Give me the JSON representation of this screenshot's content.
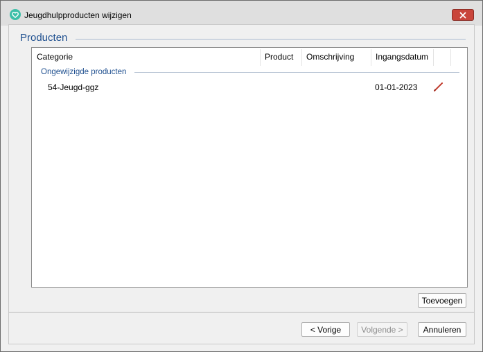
{
  "window": {
    "title": "Jeugdhulpproducten wijzigen",
    "icon": "heart-icon",
    "accent_color": "#3dbfa8"
  },
  "section": {
    "title": "Producten"
  },
  "table": {
    "columns": [
      "Categorie",
      "Product",
      "Omschrijving",
      "Ingangsdatum"
    ],
    "group": {
      "label": "Ongewijzigde producten",
      "rows": [
        {
          "categorie": "54-Jeugd-ggz",
          "product": "",
          "omschrijving": "",
          "ingangsdatum": "01-01-2023",
          "action_icon": "edit-pencil-icon"
        }
      ]
    }
  },
  "buttons": {
    "add": "Toevoegen",
    "previous": "< Vorige",
    "next": "Volgende >",
    "cancel": "Annuleren"
  }
}
